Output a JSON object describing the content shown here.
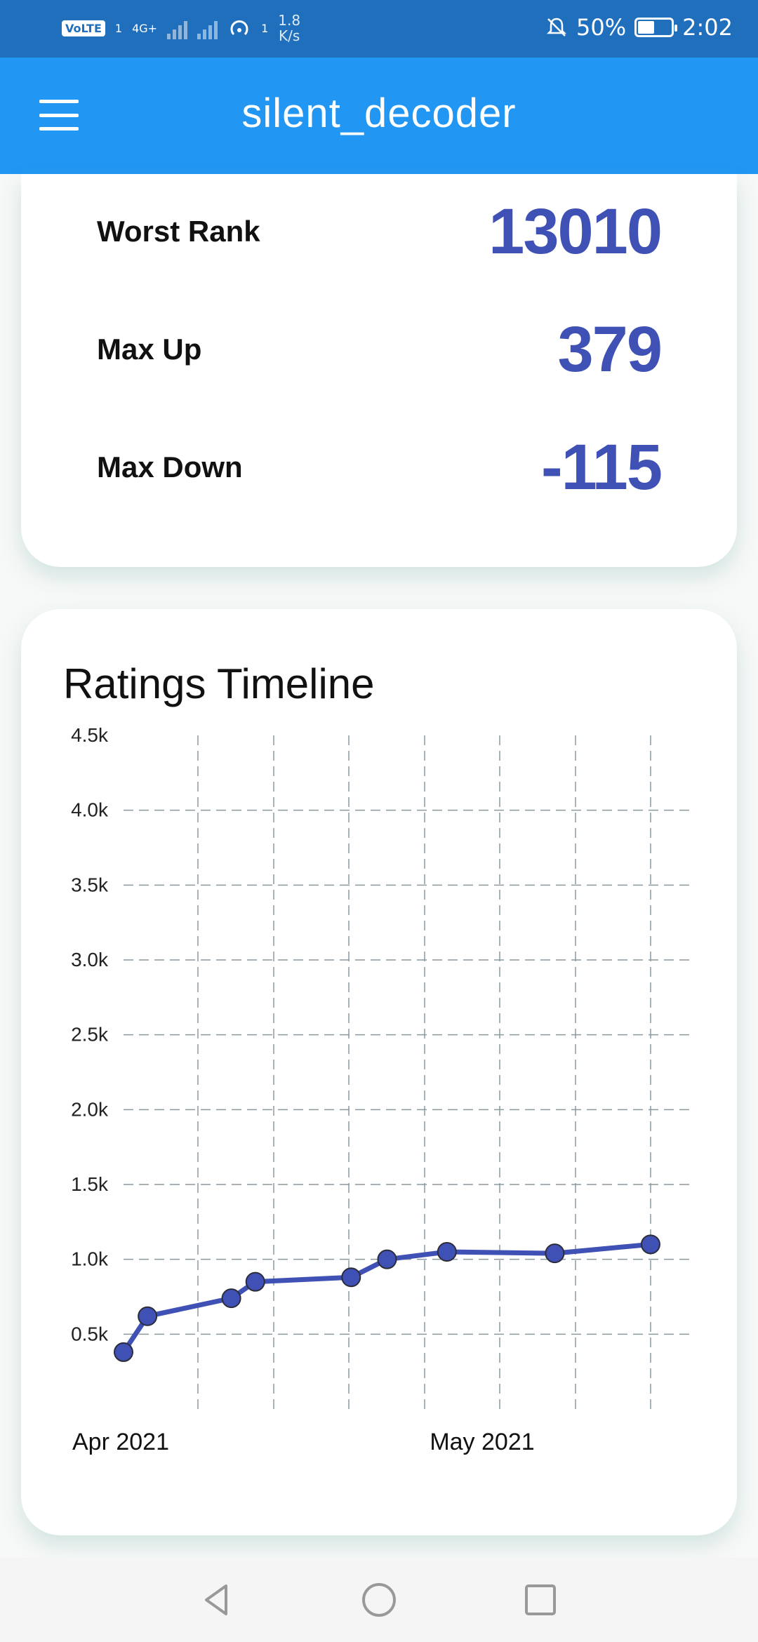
{
  "status_bar": {
    "volte": "VoLTE",
    "sim": "1",
    "network": "4G+",
    "wifi_sub": "1",
    "speed_value": "1.8",
    "speed_unit": "K/s",
    "battery": "50%",
    "time": "2:02",
    "icons": [
      "volte-icon",
      "signal-icon",
      "hotspot-icon",
      "bell-muted-icon",
      "battery-icon"
    ]
  },
  "app_bar": {
    "title": "silent_decoder",
    "menu_icon": "hamburger-menu-icon"
  },
  "stats": [
    {
      "label": "Worst Rank",
      "value": "13010"
    },
    {
      "label": "Max Up",
      "value": "379"
    },
    {
      "label": "Max Down",
      "value": "-115"
    }
  ],
  "chart_card": {
    "title": "Ratings Timeline"
  },
  "chart_data": {
    "type": "line",
    "title": "Ratings Timeline",
    "xlabel": "",
    "ylabel": "",
    "x_tick_labels": [
      "Apr 2021",
      "May 2021"
    ],
    "y_tick_labels": [
      "0.5k",
      "1.0k",
      "1.5k",
      "2.0k",
      "2.5k",
      "3.0k",
      "3.5k",
      "4.0k",
      "4.5k"
    ],
    "ylim": [
      0,
      4500
    ],
    "grid": true,
    "legend": "none",
    "series": [
      {
        "color": "#3f51b5",
        "points": [
          {
            "x": "2021-04-01",
            "y": 380
          },
          {
            "x": "2021-04-03",
            "y": 620
          },
          {
            "x": "2021-04-10",
            "y": 740
          },
          {
            "x": "2021-04-12",
            "y": 850
          },
          {
            "x": "2021-04-20",
            "y": 880
          },
          {
            "x": "2021-04-23",
            "y": 1000
          },
          {
            "x": "2021-04-28",
            "y": 1050
          },
          {
            "x": "2021-05-07",
            "y": 1040
          },
          {
            "x": "2021-05-15",
            "y": 1100
          }
        ]
      }
    ]
  },
  "nav_bar": {
    "buttons": [
      "back-icon",
      "home-icon",
      "recents-icon"
    ]
  }
}
